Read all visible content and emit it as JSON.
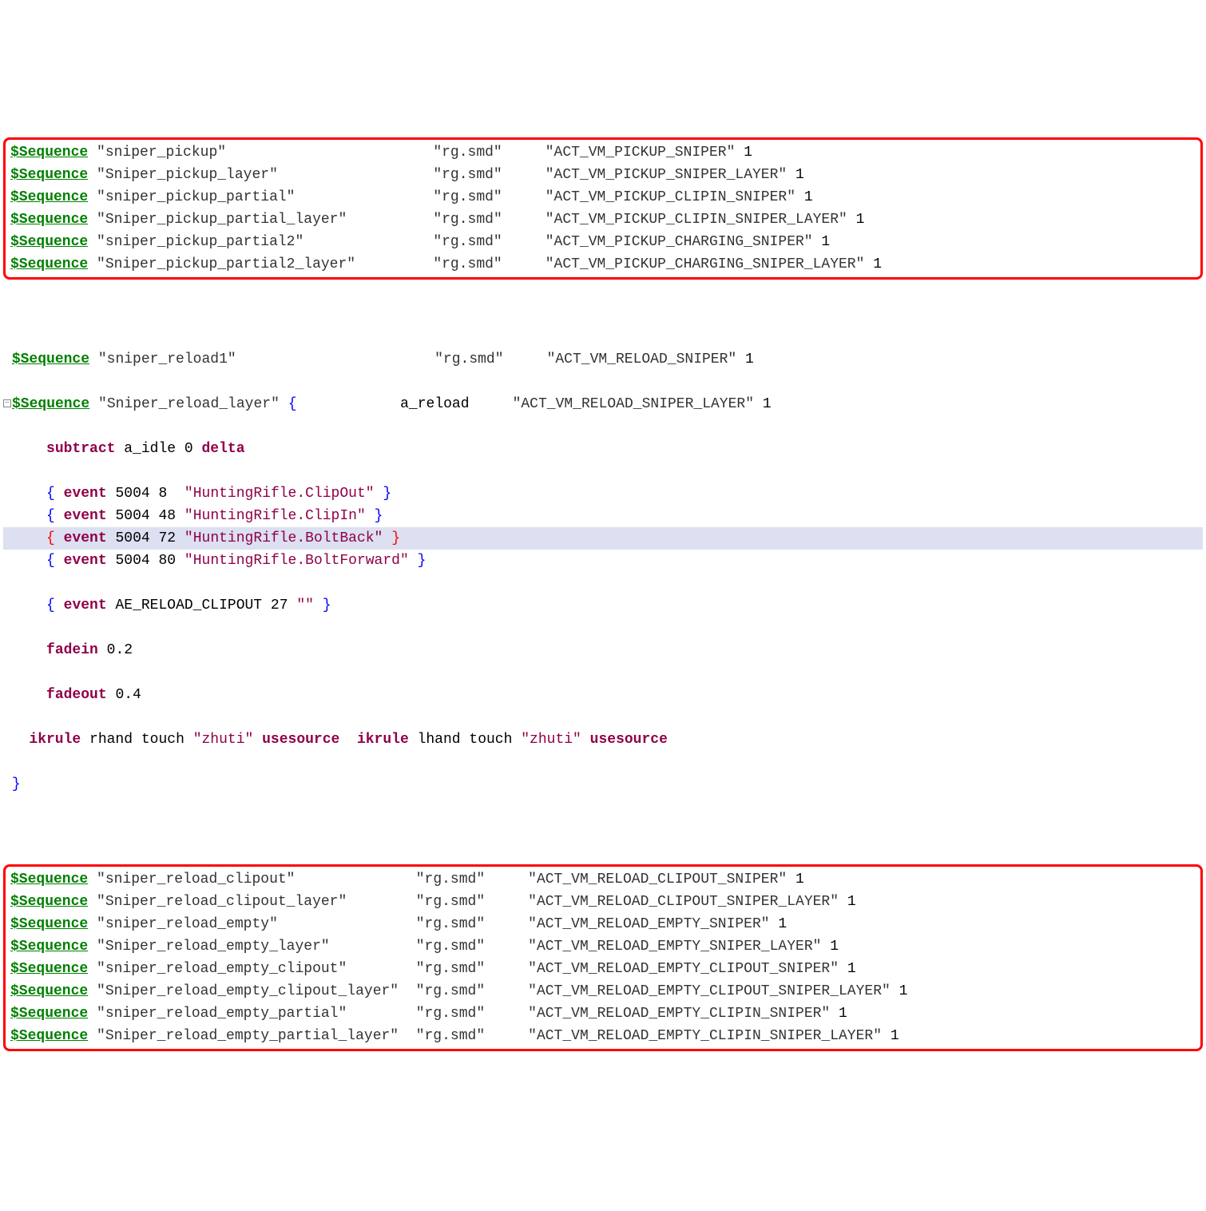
{
  "keyword": "$Sequence",
  "grp1": [
    {
      "name": "\"sniper_pickup\"",
      "pad": "                        ",
      "file": "\"rg.smd\"",
      "act": "\"ACT_VM_PICKUP_SNIPER\"",
      "w": "1"
    },
    {
      "name": "\"Sniper_pickup_layer\"",
      "pad": "                  ",
      "file": "\"rg.smd\"",
      "act": "\"ACT_VM_PICKUP_SNIPER_LAYER\"",
      "w": "1"
    },
    {
      "name": "\"sniper_pickup_partial\"",
      "pad": "                ",
      "file": "\"rg.smd\"",
      "act": "\"ACT_VM_PICKUP_CLIPIN_SNIPER\"",
      "w": "1"
    },
    {
      "name": "\"Sniper_pickup_partial_layer\"",
      "pad": "          ",
      "file": "\"rg.smd\"",
      "act": "\"ACT_VM_PICKUP_CLIPIN_SNIPER_LAYER\"",
      "w": "1"
    },
    {
      "name": "\"sniper_pickup_partial2\"",
      "pad": "               ",
      "file": "\"rg.smd\"",
      "act": "\"ACT_VM_PICKUP_CHARGING_SNIPER\"",
      "w": "1"
    },
    {
      "name": "\"Sniper_pickup_partial2_layer\"",
      "pad": "         ",
      "file": "\"rg.smd\"",
      "act": "\"ACT_VM_PICKUP_CHARGING_SNIPER_LAYER\"",
      "w": "1"
    }
  ],
  "mid": {
    "reload1": {
      "name": "\"sniper_reload1\"",
      "pad": "                       ",
      "file": "\"rg.smd\"",
      "act": "\"ACT_VM_RELOAD_SNIPER\"",
      "w": "1"
    },
    "reload_layer": {
      "name": "\"Sniper_reload_layer\"",
      "pad": "            ",
      "anim": "a_reload",
      "act": "\"ACT_VM_RELOAD_SNIPER_LAYER\"",
      "w": "1"
    },
    "subtract": {
      "kw1": "subtract",
      "arg": "a_idle",
      "n": "0",
      "kw2": "delta"
    },
    "events": [
      {
        "n1": "5004",
        "n2": "8",
        "pad": "  ",
        "s": "\"HuntingRifle.ClipOut\"",
        "hl": false
      },
      {
        "n1": "5004",
        "n2": "48",
        "pad": " ",
        "s": "\"HuntingRifle.ClipIn\"",
        "hl": false
      },
      {
        "n1": "5004",
        "n2": "72",
        "pad": " ",
        "s": "\"HuntingRifle.BoltBack\"",
        "hl": true
      },
      {
        "n1": "5004",
        "n2": "80",
        "pad": " ",
        "s": "\"HuntingRifle.BoltForward\"",
        "hl": false
      }
    ],
    "event_clip": {
      "kw": "event",
      "name": "AE_RELOAD_CLIPOUT",
      "n": "27",
      "s": "\"\""
    },
    "fadein": {
      "kw": "fadein",
      "v": "0.2"
    },
    "fadeout": {
      "kw": "fadeout",
      "v": "0.4"
    },
    "ikrule": {
      "kw": "ikrule",
      "h1": "rhand",
      "t": "touch",
      "s": "\"zhuti\"",
      "us": "usesource",
      "h2": "lhand"
    }
  },
  "grp3": [
    {
      "name": "\"sniper_reload_clipout\"",
      "pad": "              ",
      "file": "\"rg.smd\"",
      "act": "\"ACT_VM_RELOAD_CLIPOUT_SNIPER\"",
      "w": "1"
    },
    {
      "name": "\"Sniper_reload_clipout_layer\"",
      "pad": "        ",
      "file": "\"rg.smd\"",
      "act": "\"ACT_VM_RELOAD_CLIPOUT_SNIPER_LAYER\"",
      "w": "1"
    },
    {
      "name": "\"sniper_reload_empty\"",
      "pad": "                ",
      "file": "\"rg.smd\"",
      "act": "\"ACT_VM_RELOAD_EMPTY_SNIPER\"",
      "w": "1"
    },
    {
      "name": "\"Sniper_reload_empty_layer\"",
      "pad": "          ",
      "file": "\"rg.smd\"",
      "act": "\"ACT_VM_RELOAD_EMPTY_SNIPER_LAYER\"",
      "w": "1"
    },
    {
      "name": "\"sniper_reload_empty_clipout\"",
      "pad": "        ",
      "file": "\"rg.smd\"",
      "act": "\"ACT_VM_RELOAD_EMPTY_CLIPOUT_SNIPER\"",
      "w": "1"
    },
    {
      "name": "\"Sniper_reload_empty_clipout_layer\"",
      "pad": "  ",
      "file": "\"rg.smd\"",
      "act": "\"ACT_VM_RELOAD_EMPTY_CLIPOUT_SNIPER_LAYER\"",
      "w": "1"
    },
    {
      "name": "\"sniper_reload_empty_partial\"",
      "pad": "        ",
      "file": "\"rg.smd\"",
      "act": "\"ACT_VM_RELOAD_EMPTY_CLIPIN_SNIPER\"",
      "w": "1"
    },
    {
      "name": "\"Sniper_reload_empty_partial_layer\"",
      "pad": "  ",
      "file": "\"rg.smd\"",
      "act": "\"ACT_VM_RELOAD_EMPTY_CLIPIN_SNIPER_LAYER\"",
      "w": "1"
    }
  ]
}
